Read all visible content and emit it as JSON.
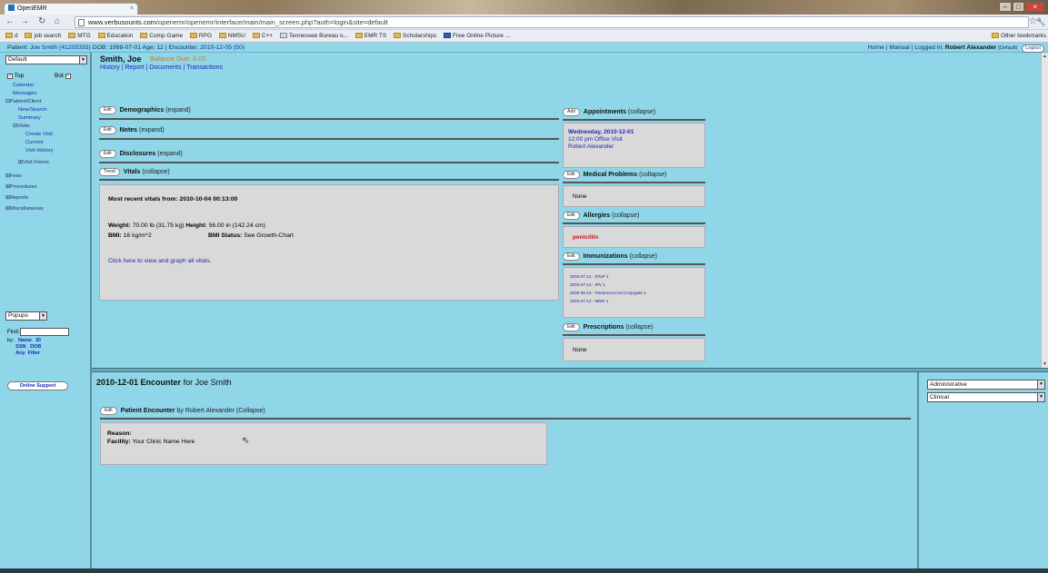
{
  "browser": {
    "tab_title": "OpenEMR",
    "url_domain": "www.verbusounts.com",
    "url_path": "/openemr/openemr/interface/main/main_screen.php?auth=login&site=default",
    "bookmarks": [
      "d",
      "job search",
      "MTG",
      "Education",
      "Comp Game",
      "RPG",
      "NMSU",
      "C++",
      "Tennessee Bureau o...",
      "EMR TS",
      "Scholarships",
      "Free Online Picture ..."
    ],
    "other_bookmarks": "Other bookmarks"
  },
  "header": {
    "patient_prefix": "Patient:",
    "patient_link": "Joe Smith (41205333)",
    "dob_text": "DOB: 1998-07-01 Age: 12 | Encounter:",
    "encounter_link": "2010-12-05 (50)",
    "home": "Home",
    "manual": "Manual",
    "logged_in": "Logged in:",
    "user": "Robert Alexander",
    "user_suffix": "(Default)",
    "logout": "Logout"
  },
  "leftnav": {
    "frame_select": "Default",
    "top_label": "Top",
    "bot_label": "Bot",
    "items": [
      "Calendar",
      "Messages",
      "Patient/Client",
      "New/Search",
      "Summary",
      "Visits",
      "Create Visit",
      "Current",
      "Visit History",
      "Visit Forms",
      "Fees",
      "Procedures",
      "Reports",
      "Miscellaneous"
    ],
    "popups_select": "Popups",
    "find_label": "Find:",
    "by_label": "by:",
    "by_row1": [
      "Name",
      "ID"
    ],
    "by_row2": [
      "SSN",
      "DOB"
    ],
    "by_row3": [
      "Any",
      "Filter"
    ],
    "online_support": "Online Support"
  },
  "summary": {
    "patient_name": "Smith, Joe",
    "balance": "Balance Due: 0.00",
    "links": "History | Report | Documents | Transactions",
    "sections": [
      {
        "button": "Edit",
        "title": "Demographics",
        "toggle": "(expand)"
      },
      {
        "button": "Edit",
        "title": "Notes",
        "toggle": "(expand)"
      },
      {
        "button": "Edit",
        "title": "Disclosures",
        "toggle": "(expand)"
      },
      {
        "button": "Trend",
        "title": "Vitals",
        "toggle": "(collapse)"
      }
    ],
    "vitals": {
      "title": "Most recent vitals from: 2010-10-04 00:13:00",
      "weight_label": "Weight:",
      "weight_value": "70.00 lb (31.75 kg)",
      "height_label": "Height:",
      "height_value": "56.00 in (142.24 cm)",
      "bmi_label": "BMI:",
      "bmi_value": "16 kg/m^2",
      "bmi_status_label": "BMI Status:",
      "bmi_status_value": "See Growth-Chart",
      "graph_link": "Click here to view and graph all vitals."
    }
  },
  "right_summary": {
    "appointments": {
      "button": "Add",
      "title": "Appointments",
      "toggle": "(collapse)",
      "date": "Wednesday, 2010-12-01",
      "time": "12:00 pm Office Visit",
      "provider": "Robert Alexander"
    },
    "medical_problems": {
      "button": "Edit",
      "title": "Medical Problems",
      "toggle": "(collapse)",
      "value": "None"
    },
    "allergies": {
      "button": "Edit",
      "title": "Allergies",
      "toggle": "(collapse)",
      "value": "penicillin"
    },
    "immunizations": {
      "button": "Edit",
      "title": "Immunizations",
      "toggle": "(collapse)",
      "items": [
        "2003-07-12 - DTaP 1",
        "2003-07-12 - IPV 1",
        "2005-06-15 - Pneumococcal Conjugate 1",
        "2003-07-12 - MMR 1"
      ]
    },
    "prescriptions": {
      "button": "Edit",
      "title": "Prescriptions",
      "toggle": "(collapse)",
      "value": "None"
    }
  },
  "encounter": {
    "title_bold": "2010-12-01 Encounter",
    "title_rest": "for Joe Smith",
    "form_button": "Edit",
    "form_title": "Patient Encounter",
    "form_by": "by Robert Alexander (Collapse)",
    "reason_label": "Reason:",
    "facility_label": "Facility:",
    "facility_value": "Your Clinic Name Here"
  },
  "right_panel": {
    "select1": "Administrative",
    "select2": "Clinical"
  },
  "colors": {
    "page_bg": "#8fd6e8",
    "link": "#1c2ab0",
    "balance": "#d07a20",
    "allergy": "#cc1111"
  }
}
